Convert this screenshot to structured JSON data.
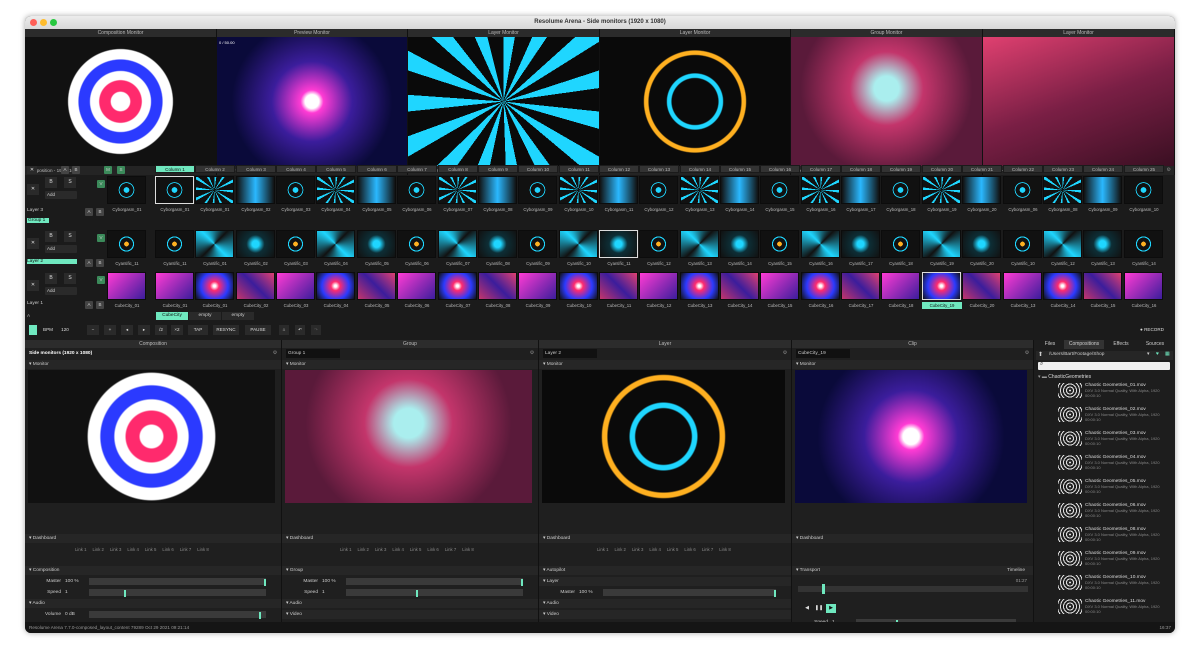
{
  "window": {
    "title": "Resolume Arena - Side monitors (1920 x 1080)"
  },
  "monitors": [
    {
      "header": "Composition Monitor",
      "footer": "Composition - 1920x1080"
    },
    {
      "header": "Preview Monitor",
      "footer": "Preview - Clip - CubeCity_19 - 1920x1080"
    },
    {
      "header": "Layer Monitor",
      "footer": "Layer 3 - 1920x1080"
    },
    {
      "header": "Layer Monitor",
      "footer": "Layer 2 - 1920x1080"
    },
    {
      "header": "Group Monitor",
      "footer": "Group 1 - 1920x1080"
    },
    {
      "header": "Layer Monitor",
      "footer": "Layer 1 - 1920x1080"
    }
  ],
  "preview_overlay": "0 / 50.00",
  "columns": [
    "Column 1",
    "Column 2",
    "Column 3",
    "Column 4",
    "Column 5",
    "Column 6",
    "Column 7",
    "Column 8",
    "Column 9",
    "Column 10",
    "Column 11",
    "Column 12",
    "Column 13",
    "Column 14",
    "Column 15",
    "Column 16",
    "Column 17",
    "Column 18",
    "Column 19",
    "Column 20",
    "Column 21",
    "Column 22",
    "Column 23",
    "Column 24",
    "Column 25"
  ],
  "layers": {
    "layer3": {
      "name": "Layer 3",
      "clips": [
        "Cyborgasm_01",
        "Cyborgasm_01",
        "Cyborgasm_02",
        "Cyborgasm_03",
        "Cyborgasm_04",
        "Cyborgasm_05",
        "Cyborgasm_06",
        "Cyborgasm_07",
        "Cyborgasm_08",
        "Cyborgasm_09",
        "Cyborgasm_10",
        "Cyborgasm_11",
        "Cyborgasm_12",
        "Cyborgasm_13",
        "Cyborgasm_14",
        "Cyborgasm_15",
        "Cyborgasm_16",
        "Cyborgasm_17",
        "Cyborgasm_18",
        "Cyborgasm_19",
        "Cyborgasm_20",
        "Cyborgasm_06",
        "Cyborgasm_08",
        "Cyborgasm_09",
        "Cyborgasm_10"
      ]
    },
    "layer2": {
      "name": "Layer 2",
      "clips": [
        "Cyantific_11",
        "Cyantific_01",
        "Cyantific_02",
        "Cyantific_03",
        "Cyantific_04",
        "Cyantific_05",
        "Cyantific_06",
        "Cyantific_07",
        "Cyantific_08",
        "Cyantific_09",
        "Cyantific_10",
        "Cyantific_11",
        "Cyantific_12",
        "Cyantific_13",
        "Cyantific_14",
        "Cyantific_15",
        "Cyantific_16",
        "Cyantific_17",
        "Cyantific_18",
        "Cyantific_19",
        "Cyantific_20",
        "Cyantific_10",
        "Cyantific_12",
        "Cyantific_13",
        "Cyantific_14"
      ]
    },
    "layer1": {
      "name": "Layer 1",
      "clips": [
        "CubeCity_01",
        "CubeCity_01",
        "CubeCity_02",
        "CubeCity_03",
        "CubeCity_04",
        "CubeCity_05",
        "CubeCity_06",
        "CubeCity_07",
        "CubeCity_08",
        "CubeCity_09",
        "CubeCity_10",
        "CubeCity_11",
        "CubeCity_12",
        "CubeCity_13",
        "CubeCity_14",
        "CubeCity_15",
        "CubeCity_16",
        "CubeCity_17",
        "CubeCity_18",
        "CubeCity_19",
        "CubeCity_20",
        "CubeCity_13",
        "CubeCity_14",
        "CubeCity_15",
        "CubeCity_16"
      ]
    }
  },
  "group": {
    "name": "Group 1"
  },
  "layer_buttons": {
    "x": "✕",
    "b": "B",
    "s": "S",
    "add": "Add",
    "a": "A",
    "bb": "B",
    "m": "M",
    "v": "V"
  },
  "deck_tabs": [
    "CubeCity",
    "empty",
    "empty"
  ],
  "transport": {
    "bpm_label": "BPM",
    "bpm": "120",
    "minus": "−",
    "plus": "+",
    "half": "/2",
    "double": "×2",
    "tap": "TAP",
    "resync": "RESYNC",
    "pause": "PAUSE",
    "record": "● RECORD"
  },
  "panels": {
    "composition": {
      "title": "Composition",
      "name": "Side monitors (1920 x 1080)",
      "monitor": "Monitor",
      "dashboard": "Dashboard",
      "section": "Composition",
      "master_label": "Master",
      "master": "100 %",
      "speed_label": "Speed",
      "speed": "1",
      "audio": "Audio",
      "volume_label": "Volume",
      "volume": "0 dB",
      "pan_label": "Pan",
      "pan": "0",
      "video": "Video"
    },
    "group": {
      "title": "Group",
      "name": "Group 1",
      "monitor": "Monitor",
      "dashboard": "Dashboard",
      "section": "Group",
      "master_label": "Master",
      "master": "100 %",
      "speed_label": "Speed",
      "speed": "1",
      "audio": "Audio",
      "video": "Video",
      "blend_label": "Blend Mode",
      "blend": "Alpha",
      "opacity_label": "Opacity",
      "opacity": "100 %"
    },
    "layer": {
      "title": "Layer",
      "name": "Layer 2",
      "monitor": "Monitor",
      "dashboard": "Dashboard",
      "autopilot": "Autopilot",
      "section": "Layer",
      "master_label": "Master",
      "master": "100 %",
      "audio": "Audio",
      "video": "Video",
      "blend_label": "Blend Mode",
      "blend": "Add",
      "opacity_label": "Opacity",
      "opacity": "50 %"
    },
    "clip": {
      "title": "Clip",
      "name": "CubeCity_19",
      "monitor": "Monitor",
      "dashboard": "Dashboard",
      "transport": "Transport",
      "timeline": "Timeline",
      "time": "01:27",
      "speed_label": "Speed",
      "speed": "1",
      "duration_label": "Duration",
      "duration": "26.7 s"
    }
  },
  "links": [
    "Link 1",
    "Link 2",
    "Link 3",
    "Link 4",
    "Link 5",
    "Link 6",
    "Link 7",
    "Link 8"
  ],
  "browser": {
    "tabs": [
      "Files",
      "Compositions",
      "Effects",
      "Sources"
    ],
    "path": "/Users/Bart/Footage/Shop",
    "folder": "ChaoticGeometries",
    "files": [
      {
        "name": "Chaotic Geometries_01.mov",
        "desc": "DXV 3.0 Normal Quality, With Alpha, 1920",
        "time": "00:00:10"
      },
      {
        "name": "Chaotic Geometries_02.mov",
        "desc": "DXV 3.0 Normal Quality, With Alpha, 1920",
        "time": "00:00:10"
      },
      {
        "name": "Chaotic Geometries_03.mov",
        "desc": "DXV 3.0 Normal Quality, With Alpha, 1920",
        "time": "00:00:10"
      },
      {
        "name": "Chaotic Geometries_04.mov",
        "desc": "DXV 3.0 Normal Quality, With Alpha, 1920",
        "time": "00:00:10"
      },
      {
        "name": "Chaotic Geometries_05.mov",
        "desc": "DXV 3.0 Normal Quality, With Alpha, 1920",
        "time": "00:00:10"
      },
      {
        "name": "Chaotic Geometries_06.mov",
        "desc": "DXV 3.0 Normal Quality, With Alpha, 1920",
        "time": "00:00:10"
      },
      {
        "name": "Chaotic Geometries_08.mov",
        "desc": "DXV 3.0 Normal Quality, With Alpha, 1920",
        "time": "00:00:10"
      },
      {
        "name": "Chaotic Geometries_09.mov",
        "desc": "DXV 3.0 Normal Quality, With Alpha, 1920",
        "time": "00:00:10"
      },
      {
        "name": "Chaotic Geometries_10.mov",
        "desc": "DXV 3.0 Normal Quality, With Alpha, 1920",
        "time": "00:00:10"
      },
      {
        "name": "Chaotic Geometries_11.mov",
        "desc": "DXV 3.0 Normal Quality, With Alpha, 1920",
        "time": "00:00:10"
      }
    ]
  },
  "status": {
    "left": "Resolume Arena 7.7.0-composed_layout_content 79289 Oct 29 2021 09:21:14",
    "right": "16:37"
  },
  "colors": {
    "accent": "#6fe8bf",
    "bg": "#1b1b1b"
  }
}
